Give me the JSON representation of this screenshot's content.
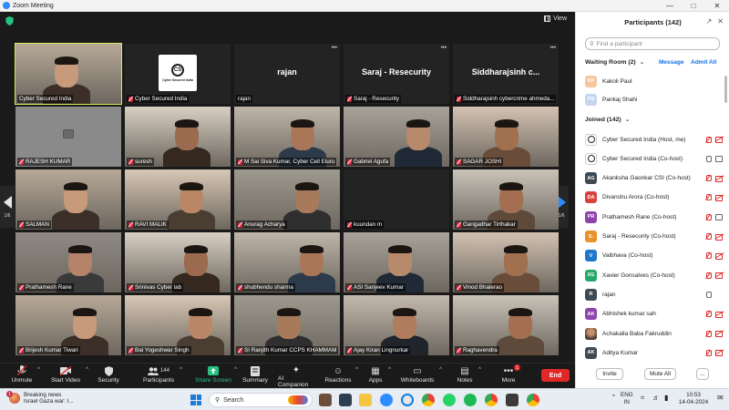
{
  "window": {
    "title": "Zoom Meeting"
  },
  "meeting": {
    "view_label": "View",
    "page_indicator_left": "1/6",
    "page_indicator_right": "1/6",
    "tiles": [
      {
        "label": "Cyber Secured India",
        "kind": "video",
        "muted": false,
        "active": true
      },
      {
        "label": "Cyber Secured India",
        "kind": "logo",
        "muted": true,
        "logo_text": "Cyber Secured India",
        "logo_mark": "CS"
      },
      {
        "label": "rajan",
        "kind": "name",
        "big": "rajan",
        "muted": false
      },
      {
        "label": "Saraj - Resecurity",
        "kind": "name",
        "big": "Saraj - Resecurity",
        "muted": true
      },
      {
        "label": "Siddharajsinh cybercrime ahmeda...",
        "kind": "name",
        "big": "Siddharajsinh c...",
        "muted": true
      },
      {
        "label": "RAJESH KUMAR",
        "kind": "camoff",
        "muted": true
      },
      {
        "label": "suresh",
        "kind": "video",
        "muted": true
      },
      {
        "label": "M Sai Siva Kumar, Cyber Cell Eluru",
        "kind": "video",
        "muted": true
      },
      {
        "label": "Gabriel Agufa",
        "kind": "video",
        "muted": true
      },
      {
        "label": "SAGAR JOSHI",
        "kind": "video",
        "muted": true
      },
      {
        "label": "SALMAN",
        "kind": "video",
        "muted": true
      },
      {
        "label": "RAVI MALIK",
        "kind": "video",
        "muted": true
      },
      {
        "label": "Anurag Acharya",
        "kind": "video",
        "muted": true
      },
      {
        "label": "kuundan m",
        "kind": "dark",
        "muted": true
      },
      {
        "label": "Gangadhar Tirthakar",
        "kind": "video",
        "muted": true
      },
      {
        "label": "Prathamesh Rane",
        "kind": "video",
        "muted": true
      },
      {
        "label": "Srinivas Cyber lab",
        "kind": "video",
        "muted": true
      },
      {
        "label": "shubhendu sharma",
        "kind": "video",
        "muted": true
      },
      {
        "label": "ASI Sanjeev Kumar",
        "kind": "video",
        "muted": true
      },
      {
        "label": "Vinod Bhalerao",
        "kind": "video",
        "muted": true
      },
      {
        "label": "Brijesh Kumar Tiwari",
        "kind": "video",
        "muted": true
      },
      {
        "label": "Bal Yogeshwar Singh",
        "kind": "video",
        "muted": true
      },
      {
        "label": "SI Ranjith Kumar CCPS KHAMMAM",
        "kind": "video",
        "muted": true
      },
      {
        "label": "Ajay Kiran Lingnurkar",
        "kind": "video",
        "muted": true
      },
      {
        "label": "Raghavendra",
        "kind": "video",
        "muted": true
      }
    ]
  },
  "toolbar": {
    "unmute": "Unmute",
    "start_video": "Start Video",
    "security": "Security",
    "participants": "Participants",
    "participants_count": "144",
    "share_screen": "Share Screen",
    "summary": "Summary",
    "ai_companion": "AI Companion",
    "reactions": "Reactions",
    "apps": "Apps",
    "whiteboards": "Whiteboards",
    "notes": "Notes",
    "more": "More",
    "more_badge": "1",
    "end": "End",
    "accent_green": "#26c281",
    "end_color": "#e02828"
  },
  "panel": {
    "title": "Participants (142)",
    "search_placeholder": "Find a participant",
    "waiting_room": "Waiting Room (2)",
    "message": "Message",
    "admit_all": "Admit All",
    "waiting": [
      {
        "name": "Kakoli Paul",
        "initials": "KP",
        "color": "#f5c7a0"
      },
      {
        "name": "Pankaj Shahi",
        "initials": "PS",
        "color": "#c5d5f0"
      }
    ],
    "joined": "Joined (142)",
    "participants": [
      {
        "name": "Cyber Secured India (Host, me)",
        "initials": "CS",
        "color": "#ffffff",
        "logo": true,
        "mic": "off",
        "cam": "off"
      },
      {
        "name": "Cyber Secured India (Co-host)",
        "initials": "CS",
        "color": "#ffffff",
        "logo": true,
        "mic": "on",
        "cam": "on"
      },
      {
        "name": "Akanksha Gaonkar CSI (Co-host)",
        "initials": "AG",
        "color": "#3e4a55",
        "mic": "off",
        "cam": "off"
      },
      {
        "name": "Divanshu Arora (Co-host)",
        "initials": "DA",
        "color": "#d9423b",
        "mic": "off",
        "cam": "off"
      },
      {
        "name": "Prathamesh Rane (Co-host)",
        "initials": "PR",
        "color": "#8e44ad",
        "mic": "off",
        "cam": "on"
      },
      {
        "name": "Saraj - Resecurity (Co-host)",
        "initials": "S-",
        "color": "#e8922b",
        "mic": "off",
        "cam": "off"
      },
      {
        "name": "Vaibhava (Co-host)",
        "initials": "V",
        "color": "#1f78c8",
        "mic": "off",
        "cam": "off"
      },
      {
        "name": "Xavier Gonsalves (Co-host)",
        "initials": "XG",
        "color": "#27a86b",
        "mic": "off",
        "cam": "off"
      },
      {
        "name": "rajan",
        "initials": "R",
        "color": "#3e4a55",
        "mic": "on",
        "cam": "none"
      },
      {
        "name": "Abhishek kumar sah",
        "initials": "AK",
        "color": "#8e44ad",
        "mic": "off",
        "cam": "off"
      },
      {
        "name": "Achakalla Baba Fakruddin",
        "initials": "",
        "color": "#a08060",
        "photo": true,
        "mic": "off",
        "cam": "off"
      },
      {
        "name": "Aditya Kumar",
        "initials": "AK",
        "color": "#3e4a55",
        "mic": "off",
        "cam": "off"
      }
    ],
    "invite": "Invite",
    "mute_all": "Mute All",
    "more": "..."
  },
  "taskbar": {
    "news_title": "Breaking news",
    "news_sub": "Israel Gaza war: I...",
    "news_badge": "1",
    "search": "Search",
    "lang": "ENG",
    "region": "IN",
    "time": "10:53",
    "date": "14-04-2024"
  }
}
